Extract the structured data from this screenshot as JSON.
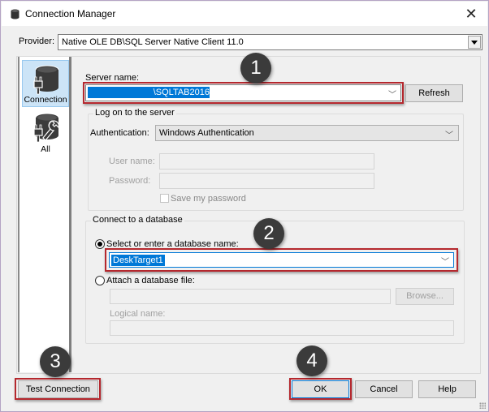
{
  "window": {
    "title": "Connection Manager",
    "close_glyph": "✕"
  },
  "provider": {
    "label": "Provider:",
    "value": "Native OLE DB\\SQL Server Native Client 11.0"
  },
  "nav": {
    "items": [
      {
        "label": "Connection",
        "icon": "database-plug-icon",
        "selected": true
      },
      {
        "label": "All",
        "icon": "database-plug-wrench-icon",
        "selected": false
      }
    ]
  },
  "server": {
    "label": "Server name:",
    "value": "\\SQLTAB2016",
    "refresh_label": "Refresh"
  },
  "logon": {
    "group_title": "Log on to the server",
    "auth_label": "Authentication:",
    "auth_value": "Windows Authentication",
    "username_label": "User name:",
    "username_value": "",
    "password_label": "Password:",
    "password_value": "",
    "save_password_label": "Save my password",
    "save_password_checked": false
  },
  "database": {
    "group_title": "Connect to a database",
    "select_option_label": "Select or enter a database name:",
    "select_option_checked": true,
    "database_name": "DeskTarget1",
    "attach_option_label": "Attach a database file:",
    "attach_option_checked": false,
    "attach_file_value": "",
    "browse_label": "Browse...",
    "logical_name_label": "Logical name:",
    "logical_name_value": ""
  },
  "footer": {
    "test_connection_label": "Test Connection",
    "ok_label": "OK",
    "cancel_label": "Cancel",
    "help_label": "Help"
  },
  "annotations": {
    "badges": [
      "1",
      "2",
      "3",
      "4"
    ],
    "highlight_color": "#b5282e",
    "badge_color": "#3b3b3b"
  },
  "colors": {
    "selection_blue": "#0078d7",
    "nav_selected_bg": "#cce4f7"
  }
}
